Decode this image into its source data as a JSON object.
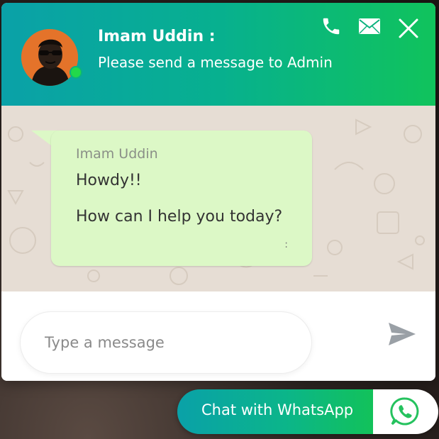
{
  "header": {
    "name": "Imam Uddin :",
    "subtitle": "Please send a message to Admin",
    "icons": [
      "phone-icon",
      "mail-icon",
      "close-icon"
    ]
  },
  "message": {
    "sender": "Imam Uddin",
    "line1": "Howdy!!",
    "line2": "How can I help you today?",
    "time": ":"
  },
  "composer": {
    "placeholder": "Type a message",
    "send_icon": "send-icon"
  },
  "launcher": {
    "label": "Chat with WhatsApp",
    "icon": "whatsapp-icon"
  },
  "colors": {
    "gradient_start": "#0aa1a8",
    "gradient_end": "#10c35c",
    "bubble": "#dcf8c6",
    "chat_bg": "#e6ddd4",
    "online": "#22d94a"
  }
}
